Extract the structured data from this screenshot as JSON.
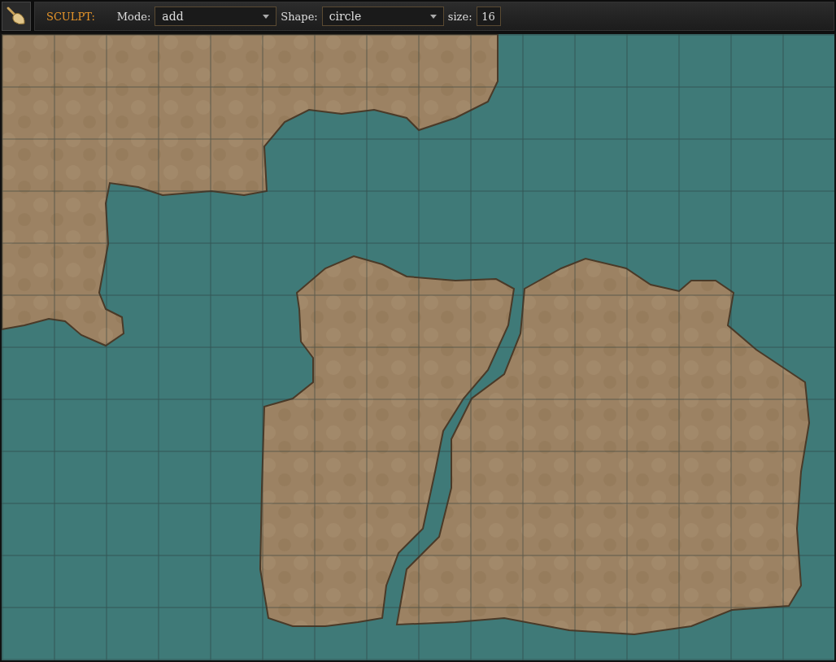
{
  "toolbar": {
    "tool_label": "SCULPT:",
    "mode": {
      "label": "Mode:",
      "value": "add"
    },
    "shape": {
      "label": "Shape:",
      "value": "circle"
    },
    "size": {
      "label": "size:",
      "value": "16"
    }
  }
}
